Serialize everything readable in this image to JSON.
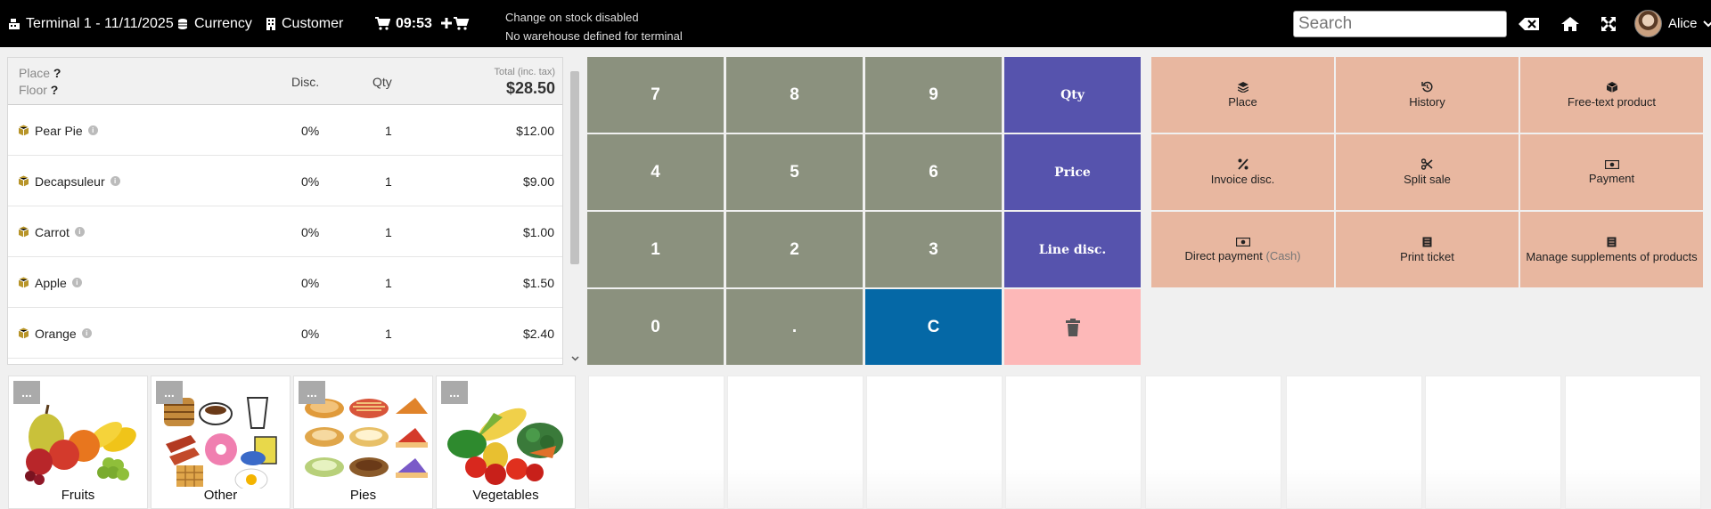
{
  "topbar": {
    "terminal": "Terminal 1 - 11/11/2025",
    "currency": "Currency",
    "customer": "Customer",
    "clock": "09:53",
    "status_line1": "Change on stock disabled",
    "status_line2": "No warehouse defined for terminal",
    "search_placeholder": "Search",
    "user": "Alice"
  },
  "order": {
    "place_label": "Place",
    "place_value": "?",
    "floor_label": "Floor",
    "floor_value": "?",
    "col_disc": "Disc.",
    "col_qty": "Qty",
    "total_label": "Total (inc. tax)",
    "total": "$28.50",
    "lines": [
      {
        "name": "Pear Pie",
        "disc": "0%",
        "qty": "1",
        "price": "$12.00"
      },
      {
        "name": "Decapsuleur",
        "disc": "0%",
        "qty": "1",
        "price": "$9.00"
      },
      {
        "name": "Carrot",
        "disc": "0%",
        "qty": "1",
        "price": "$1.00"
      },
      {
        "name": "Apple",
        "disc": "0%",
        "qty": "1",
        "price": "$1.50"
      },
      {
        "name": "Orange",
        "disc": "0%",
        "qty": "1",
        "price": "$2.40"
      }
    ]
  },
  "keypad": {
    "k7": "7",
    "k8": "8",
    "k9": "9",
    "qty": "Qty",
    "k4": "4",
    "k5": "5",
    "k6": "6",
    "price": "Price",
    "k1": "1",
    "k2": "2",
    "k3": "3",
    "line_disc": "Line disc.",
    "k0": "0",
    "dot": ".",
    "clear": "C"
  },
  "actions": {
    "place": "Place",
    "history": "History",
    "free_text": "Free-text product",
    "invoice_disc": "Invoice disc.",
    "split_sale": "Split sale",
    "payment": "Payment",
    "direct_payment": "Direct payment",
    "direct_payment_mode": "(Cash)",
    "print_ticket": "Print ticket",
    "manage_supplements": "Manage supplements of products"
  },
  "categories": [
    {
      "label": "Fruits",
      "more": "..."
    },
    {
      "label": "Other",
      "more": "..."
    },
    {
      "label": "Pies",
      "more": "..."
    },
    {
      "label": "Vegetables",
      "more": "..."
    }
  ],
  "colors": {
    "keypad_number": "#8b917e",
    "keypad_function": "#5653ad",
    "keypad_clear": "#0568a6",
    "keypad_delete": "#fdb8b8",
    "action_button": "#e8b7a0"
  }
}
